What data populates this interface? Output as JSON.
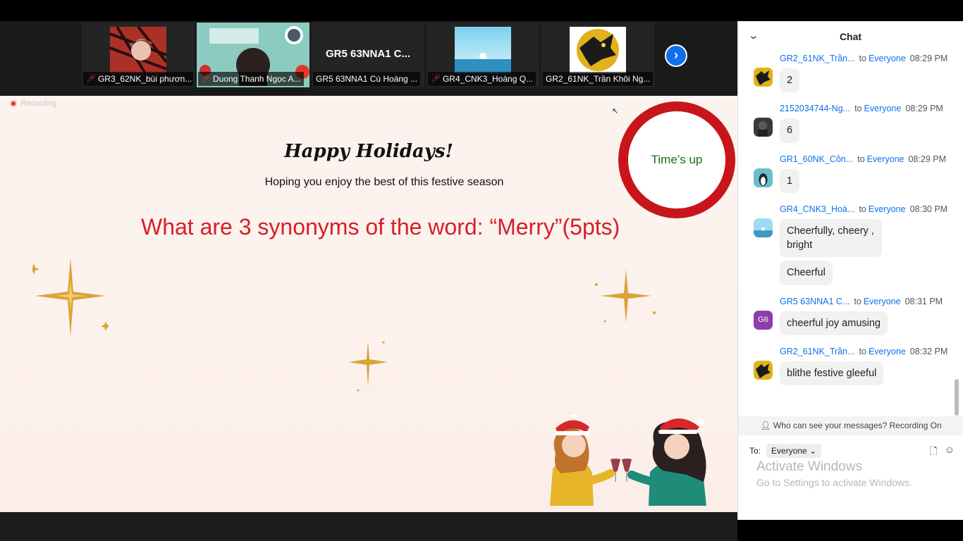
{
  "participants": [
    {
      "name": "GR3_62NK_bùi phươn...",
      "muted": true,
      "thumb_color": "#c0392b"
    },
    {
      "name": "Duong Thanh Ngọc A...",
      "muted": true,
      "thumb_color": "#7fc3b8",
      "active": true
    },
    {
      "name": "GR5 63NNA1 Cù Hoàng ...",
      "muted": false,
      "big_label": "GR5 63NNA1 C..."
    },
    {
      "name": "GR4_CNK3_Hoàng Q...",
      "muted": true,
      "thumb_color": "#4fb0d9"
    },
    {
      "name": "GR2_61NK_Trần Khôi Ng...",
      "muted": false,
      "thumb_color": "#1d1d1d"
    }
  ],
  "slide": {
    "recording_label": "Recording",
    "title": "Happy Holidays!",
    "subtitle": "Hoping you enjoy the best of this festive season",
    "question": "What are 3 synonyms of the word: “Merry”(5pts)",
    "timer_text": "Time’s up"
  },
  "chat": {
    "title": "Chat",
    "to_word": "to",
    "messages": [
      {
        "sender": "GR2_61NK_Trần...",
        "recipient": "Everyone",
        "time": "08:29 PM",
        "avatar": "wolf",
        "avatar_text": "",
        "texts": [
          "2"
        ]
      },
      {
        "sender": "2152034744-Ng...",
        "recipient": "Everyone",
        "time": "08:29 PM",
        "avatar": "dark",
        "avatar_text": "",
        "texts": [
          "6"
        ]
      },
      {
        "sender": "GR1_60NK_Côn...",
        "recipient": "Everyone",
        "time": "08:29 PM",
        "avatar": "penguin",
        "avatar_text": "",
        "texts": [
          "1"
        ]
      },
      {
        "sender": "GR4_CNK3_Hoà...",
        "recipient": "Everyone",
        "time": "08:30 PM",
        "avatar": "sky",
        "avatar_text": "",
        "texts": [
          "Cheerfully, cheery , bright",
          "Cheerful"
        ]
      },
      {
        "sender": "GR5 63NNA1 C...",
        "recipient": "Everyone",
        "time": "08:31 PM",
        "avatar": "initials",
        "avatar_text": "G6",
        "texts": [
          "cheerful joy amusing"
        ]
      },
      {
        "sender": "GR2_61NK_Trần...",
        "recipient": "Everyone",
        "time": "08:32 PM",
        "avatar": "wolf",
        "avatar_text": "",
        "texts": [
          "blithe festive gleeful"
        ]
      }
    ],
    "visibility_note": "Who can see your messages? Recording On",
    "to_label": "To:",
    "to_value": "Everyone",
    "watermark_title": "Activate Windows",
    "watermark_sub": "Go to Settings to activate Windows."
  },
  "colors": {
    "accent": "#0e71eb",
    "timer_ring": "#c8151b",
    "question": "#d51f26"
  }
}
